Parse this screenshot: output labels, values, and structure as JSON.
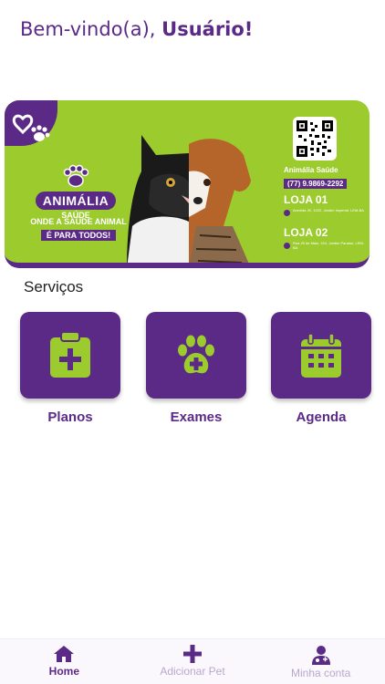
{
  "header": {
    "greeting": "Bem-vindo(a), ",
    "user": "Usuário!"
  },
  "banner": {
    "brand_logo_title": "ANIMÁLIA",
    "brand_logo_sub": "SAÚDE",
    "slogan_line1": "ONDE A SAÚDE ANIMAL",
    "slogan_line2": "É PARA TODOS!",
    "brand_name": "Animália Saúde",
    "phone": "(77) 9.9869-2292",
    "store1_title": "LOJA 01",
    "store1_address": "Avenida JK, 1022, Jardim Imperial, LEM-BA",
    "store2_title": "LOJA 02",
    "store2_address": "Rua 25 de Maio, 510, Jardim Paraíso, LEM-BA"
  },
  "services": {
    "title": "Serviços",
    "items": [
      {
        "label": "Planos",
        "icon": "clipboard-plus-icon"
      },
      {
        "label": "Exames",
        "icon": "paw-plus-icon"
      },
      {
        "label": "Agenda",
        "icon": "calendar-icon"
      }
    ]
  },
  "nav": {
    "items": [
      {
        "label": "Home",
        "icon": "home-icon",
        "active": true
      },
      {
        "label": "Adicionar Pet",
        "icon": "plus-icon",
        "active": false
      },
      {
        "label": "Minha conta",
        "icon": "user-doctor-icon",
        "active": false
      }
    ]
  },
  "colors": {
    "primary": "#5b2a86",
    "accent": "#9ccb2e",
    "inactive": "#b9a8c9"
  }
}
